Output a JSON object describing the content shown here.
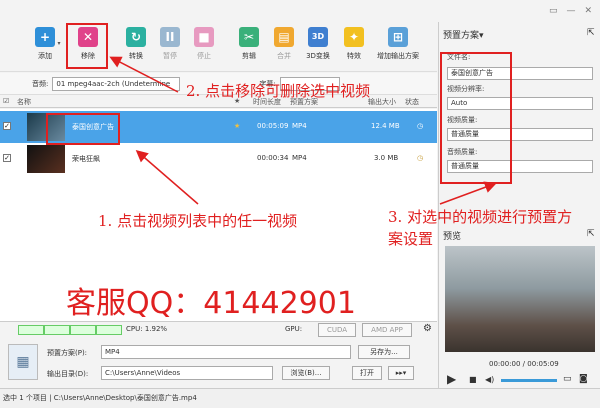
{
  "toolbar": {
    "add": "添加",
    "remove": "移除",
    "convert": "转换",
    "pause": "暂停",
    "stop": "停止",
    "cut": "剪辑",
    "merge": "合并",
    "three_d": "3D变换",
    "effects": "特效",
    "add_output": "增加输出方案"
  },
  "audio": {
    "label": "音频:",
    "value": "01 mpeg4aac-2ch (Undetermine",
    "subtitle_label": "字幕:"
  },
  "list_header": {
    "name": "名称",
    "duration": "时间长度",
    "preset": "预置方案",
    "output_size": "输出大小",
    "status": "状态"
  },
  "files": [
    {
      "name": "泰国创意广告",
      "duration": "00:05:09",
      "format": "MP4",
      "size": "12.4 MB",
      "checked": "✓"
    },
    {
      "name": "荣电狂飙",
      "duration": "00:00:34",
      "format": "MP4",
      "size": "3.0 MB",
      "checked": "✓"
    }
  ],
  "bottom_bar": {
    "cpu": "CPU: 1.92%",
    "gpu": "GPU:",
    "cuda": "CUDA",
    "amd": "AMD APP"
  },
  "output": {
    "preset_label": "预置方案(P):",
    "preset_value": "MP4",
    "save_as": "另存为...",
    "dir_label": "输出目录(D):",
    "dir_value": "C:\\Users\\Anne\\Videos",
    "browse": "浏览(B)...",
    "open": "打开"
  },
  "status_bar": "选中 1 个项目 | C:\\Users\\Anne\\Desktop\\泰国创意广告.mp4",
  "right_panel": {
    "title": "预置方案▾",
    "file_name_label": "文件名:",
    "file_name": "泰国创意广告",
    "resolution_label": "视频分辨率:",
    "resolution": "Auto",
    "video_quality_label": "视频质量:",
    "video_quality": "普通质量",
    "audio_quality_label": "音频质量:",
    "audio_quality": "普通质量",
    "preview_title": "预览",
    "time": "00:00:00 / 00:05:09"
  },
  "annotations": {
    "a1": "1. 点击视频列表中的任一视频",
    "a2": "2. 点击移除可删除选中视频",
    "a3_line1": "3. 对选中的视频进行预置方",
    "a3_line2": "案设置",
    "contact": "客服QQ：41442901"
  },
  "colors": {
    "annotation": "#e02020",
    "selection": "#4aa3e8"
  }
}
